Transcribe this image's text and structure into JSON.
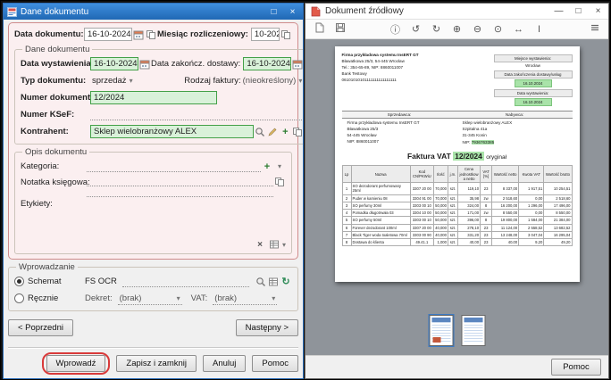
{
  "icons": {
    "minimize": "—",
    "maximize": "□",
    "close": "×",
    "dropdown": "▾",
    "plus": "+",
    "x": "×",
    "refresh": "↻"
  },
  "left_window": {
    "title": "Dane dokumentu",
    "fields": {
      "doc_date_label": "Data dokumentu:",
      "doc_date_value": "16-10-2024",
      "month_label": "Miesiąc rozliczeniowy:",
      "month_value": "10-2024"
    },
    "doc_group": {
      "legend": "Dane dokumentu",
      "issue_label": "Data wystawienia:",
      "issue_value": "16-10-2024",
      "delivery_label": "Data zakończ. dostawy:",
      "delivery_value": "16-10-2024",
      "type_label": "Typ dokumentu:",
      "type_value": "sprzedaż",
      "kind_label": "Rodzaj faktury:",
      "kind_value": "(nieokreślony)",
      "number_label": "Numer dokumentu:",
      "number_value": "12/2024",
      "ksef_label": "Numer KSeF:",
      "contractor_label": "Kontrahent:",
      "contractor_value": "Sklep wielobranżowy ALEX"
    },
    "desc_group": {
      "legend": "Opis dokumentu",
      "category_label": "Kategoria:",
      "note_label": "Notatka księgowa:",
      "labels_label": "Etykiety:"
    },
    "entry_group": {
      "legend": "Wprowadzanie",
      "scheme_label": "Schemat",
      "scheme_value": "FS OCR",
      "manual_label": "Ręcznie",
      "decree_label": "Dekret:",
      "decree_value": "(brak)",
      "vat_label": "VAT:",
      "vat_value": "(brak)"
    },
    "buttons": {
      "prev": "< Poprzedni",
      "next": "Następny >",
      "submit": "Wprowadź",
      "save_close": "Zapisz i zamknij",
      "cancel": "Anuluj",
      "help": "Pomoc"
    }
  },
  "right_window": {
    "title": "Dokument źródłowy",
    "toolbar_icons": [
      {
        "name": "info-icon",
        "glyph": "ⓘ"
      },
      {
        "name": "rotate-left-icon",
        "glyph": "↺"
      },
      {
        "name": "rotate-right-icon",
        "glyph": "↻"
      },
      {
        "name": "zoom-in-icon",
        "glyph": "⊕"
      },
      {
        "name": "zoom-out-icon",
        "glyph": "⊖"
      },
      {
        "name": "zoom-actual-icon",
        "glyph": "⊙"
      },
      {
        "name": "fit-width-icon",
        "glyph": "↔"
      },
      {
        "name": "text-select-icon",
        "glyph": "I"
      }
    ],
    "bottom": {
      "help": "Pomoc"
    },
    "invoice": {
      "sender_lines": [
        "Firma przykładowa systemu InsERT GT",
        "Bławatkowa 25/3, 54-445 Wrocław",
        "Tel.: 354-65-89, NIP: 8860011007",
        "Bank Testowy",
        "06101010101111111111111111"
      ],
      "place_label": "Miejsce wystawienia:",
      "place_value": "Wrocław",
      "delivery_label": "Data zakończenia dostawy/usług",
      "delivery_value": "16.10.2024",
      "issue_label": "Data wystawienia:",
      "issue_value": "16.10.2024",
      "seller_header": "Sprzedawca:",
      "seller_lines": [
        "Firma przykładowa systemu InsERT GT",
        "Bławatkowa 25/3",
        "54-445 Wrocław",
        "NIP: 8860011007"
      ],
      "buyer_header": "Nabywca:",
      "buyer_lines": [
        "Sklep wielobranżowy ALEX",
        "Szpitalna 41a",
        "31-345 Konin"
      ],
      "buyer_nip_label": "NIP:",
      "buyer_nip_value": "7936763385",
      "title_prefix": "Faktura VAT",
      "title_number": "12/2024",
      "title_suffix": "oryginał",
      "table": {
        "headers": [
          "Lp",
          "Nazwa",
          "Kod CN/PKWiU",
          "Ilość",
          "j.m.",
          "Cena jednostkowa netto",
          "VAT [%]",
          "Wartość netto",
          "Kwota VAT",
          "Wartość brutto"
        ],
        "rows": [
          [
            "1",
            "SO dezodorant perfumowany 25ml",
            "3307 20 00",
            "70,000",
            "szt.",
            "119,10",
            "23",
            "8 337,00",
            "1 917,51",
            "10 254,51"
          ],
          [
            "2",
            "Puder w kamieniu 08",
            "3304 91 00",
            "70,000",
            "szt.",
            "35,98",
            "zw",
            "2 518,60",
            "0,00",
            "2 518,60"
          ],
          [
            "3",
            "SO perfumy 30ml",
            "3303 00 10",
            "50,000",
            "szt.",
            "324,00",
            "8",
            "16 200,00",
            "1 296,00",
            "17 496,00"
          ],
          [
            "4",
            "Pomadka długotrwała 03",
            "3304 10 00",
            "50,000",
            "szt.",
            "171,00",
            "zw",
            "8 550,00",
            "0,00",
            "8 550,00"
          ],
          [
            "5",
            "SO perfumy 50ml",
            "3303 00 10",
            "50,000",
            "szt.",
            "396,00",
            "8",
            "19 800,00",
            "1 584,00",
            "21 384,00"
          ],
          [
            "6",
            "Forever dezodorant 100ml",
            "3307 20 00",
            "40,000",
            "szt.",
            "278,10",
            "23",
            "11 124,00",
            "2 558,52",
            "13 682,52"
          ],
          [
            "7",
            "Black Tiger woda toaletowa 70ml",
            "3303 00 90",
            "40,000",
            "szt.",
            "331,20",
            "23",
            "13 248,00",
            "3 047,04",
            "16 295,04"
          ],
          [
            "8",
            "Dostawa do klienta",
            "49.41.1",
            "1,000",
            "szt.",
            "40,00",
            "23",
            "40,00",
            "9,20",
            "49,20"
          ]
        ]
      }
    }
  }
}
